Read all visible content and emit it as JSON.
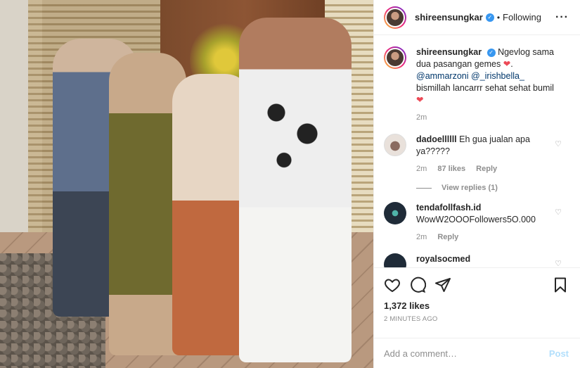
{
  "header": {
    "username": "shireensungkar",
    "separator": "•",
    "follow_status": "Following",
    "more_icon": "more-horizontal-icon"
  },
  "caption": {
    "username": "shireensungkar",
    "text_1": "Ngevlog sama dua pasangan gemes",
    "heart": "❤",
    "text_2": ".",
    "mention_1": "@ammarzoni",
    "mention_2": "@_irishbella_",
    "text_3": "bismillah lancarrr sehat sehat bumil",
    "time": "2m"
  },
  "comments": [
    {
      "username": "dadoellllll",
      "text": "Eh gua jualan apa ya?????",
      "time": "2m",
      "likes": "87 likes",
      "reply": "Reply",
      "view_replies": "View replies (1)"
    },
    {
      "username": "tendafollfash.id",
      "text": "WowW2OOOFollowers5O.000",
      "time": "2m",
      "reply": "Reply"
    },
    {
      "username": "royalsocmed"
    }
  ],
  "actions": {
    "likes_count": "1,372 likes",
    "posted_ago": "2 MINUTES AGO"
  },
  "add_comment": {
    "placeholder": "Add a comment…",
    "post_label": "Post"
  },
  "colors": {
    "verified": "#3897f0",
    "heart": "#ed4956",
    "mention": "#00376b",
    "post_button": "#b2dffc",
    "muted": "#8e8e8e"
  }
}
